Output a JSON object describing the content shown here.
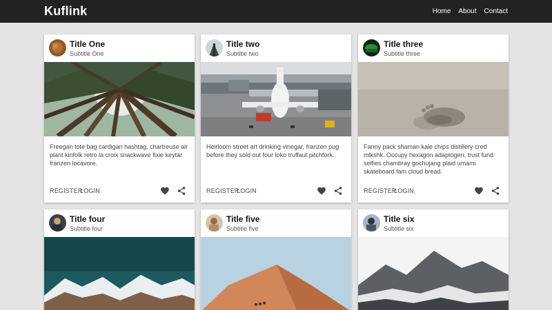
{
  "navbar": {
    "brand": "Kuflink",
    "links": [
      "Home",
      "About",
      "Contact"
    ]
  },
  "cards": [
    {
      "title": "Title One",
      "subtitle": "Subtitle One",
      "image": "forest-canopy-photo",
      "text": "Freegan tote bag cardigan hashtag, chartreuse air plant kinfolk retro la croix snackwave fixie keytar franzen locavore.",
      "actions": [
        "REGISTER",
        "LOGIN"
      ]
    },
    {
      "title": "Title two",
      "subtitle": "Subtitle two",
      "image": "airplane-at-gate-photo",
      "text": "Heirloom street art drinking vinegar, franzen pug before they sold out four loko truffaut pitchfork..",
      "actions": [
        "REGISTER",
        "LOGIN"
      ]
    },
    {
      "title": "Title three",
      "subtitle": "Subtitle three",
      "image": "footprint-in-sand-photo",
      "text": "Fanny pack shaman kale chips distillery cred mlkshk. Occupy hexagon adaptogen, trust fund selfies chambray gochujang plaid umami skateboard fam cloud bread.",
      "actions": [
        "REGISTER",
        "LOGIN"
      ]
    },
    {
      "title": "Title four",
      "subtitle": "Subtitle four",
      "image": "snowy-mountains-night-photo",
      "text": "",
      "actions": []
    },
    {
      "title": "Title five",
      "subtitle": "Subtitle five",
      "image": "desert-dune-photo",
      "text": "",
      "actions": []
    },
    {
      "title": "Title six",
      "subtitle": "Subtitle six",
      "image": "misty-mountain-photo",
      "text": "",
      "actions": []
    }
  ],
  "icons": {
    "like": "heart-icon",
    "share": "share-icon"
  }
}
